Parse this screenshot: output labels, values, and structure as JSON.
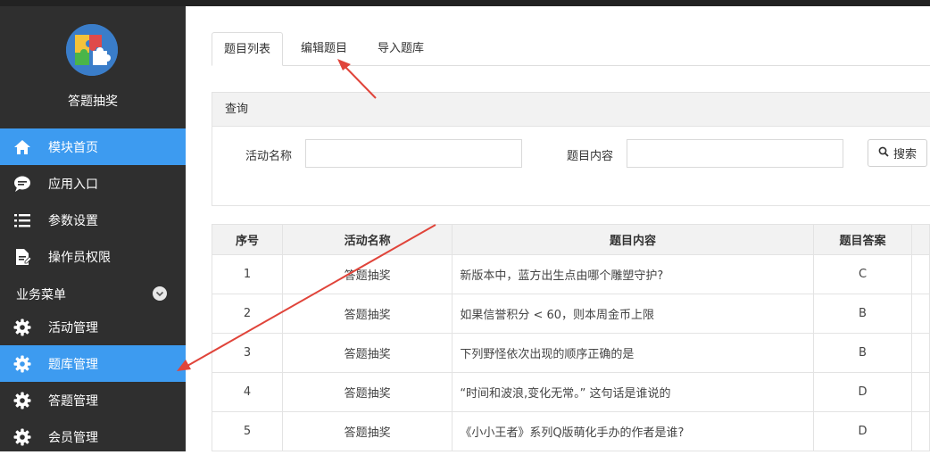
{
  "sidebar": {
    "app_name": "答题抽奖",
    "items": [
      {
        "label": "模块首页",
        "icon": "home-icon",
        "active": true
      },
      {
        "label": "应用入口",
        "icon": "chat-bubble-icon",
        "active": false
      },
      {
        "label": "参数设置",
        "icon": "list-icon",
        "active": false
      },
      {
        "label": "操作员权限",
        "icon": "document-edit-icon",
        "active": false
      }
    ],
    "group_label": "业务菜单",
    "group_items": [
      {
        "label": "活动管理",
        "icon": "gear-icon",
        "active": false
      },
      {
        "label": "题库管理",
        "icon": "gear-icon",
        "active": true
      },
      {
        "label": "答题管理",
        "icon": "gear-icon",
        "active": false
      },
      {
        "label": "会员管理",
        "icon": "gear-icon",
        "active": false
      }
    ]
  },
  "tabs": [
    {
      "label": "题目列表",
      "active": true
    },
    {
      "label": "编辑题目",
      "active": false
    },
    {
      "label": "导入题库",
      "active": false
    }
  ],
  "query": {
    "title": "查询",
    "activity_label": "活动名称",
    "activity_value": "",
    "content_label": "题目内容",
    "content_value": "",
    "search_label": "搜索"
  },
  "table": {
    "headers": [
      "序号",
      "活动名称",
      "题目内容",
      "题目答案"
    ],
    "rows": [
      {
        "no": "1",
        "activity": "答题抽奖",
        "content": "新版本中，蓝方出生点由哪个雕塑守护?",
        "answer": "C"
      },
      {
        "no": "2",
        "activity": "答题抽奖",
        "content": "如果信誉积分 < 60，则本周金币上限",
        "answer": "B"
      },
      {
        "no": "3",
        "activity": "答题抽奖",
        "content": "下列野怪依次出现的顺序正确的是",
        "answer": "B"
      },
      {
        "no": "4",
        "activity": "答题抽奖",
        "content": "“时间和波浪,变化无常。” 这句话是谁说的",
        "answer": "D"
      },
      {
        "no": "5",
        "activity": "答题抽奖",
        "content": "《小小王者》系列Q版萌化手办的作者是谁?",
        "answer": "D"
      }
    ]
  },
  "colors": {
    "sidebar_bg": "#2f2f2f",
    "active_bg": "#3d9bf0",
    "annotation_arrow": "#e0443a"
  }
}
